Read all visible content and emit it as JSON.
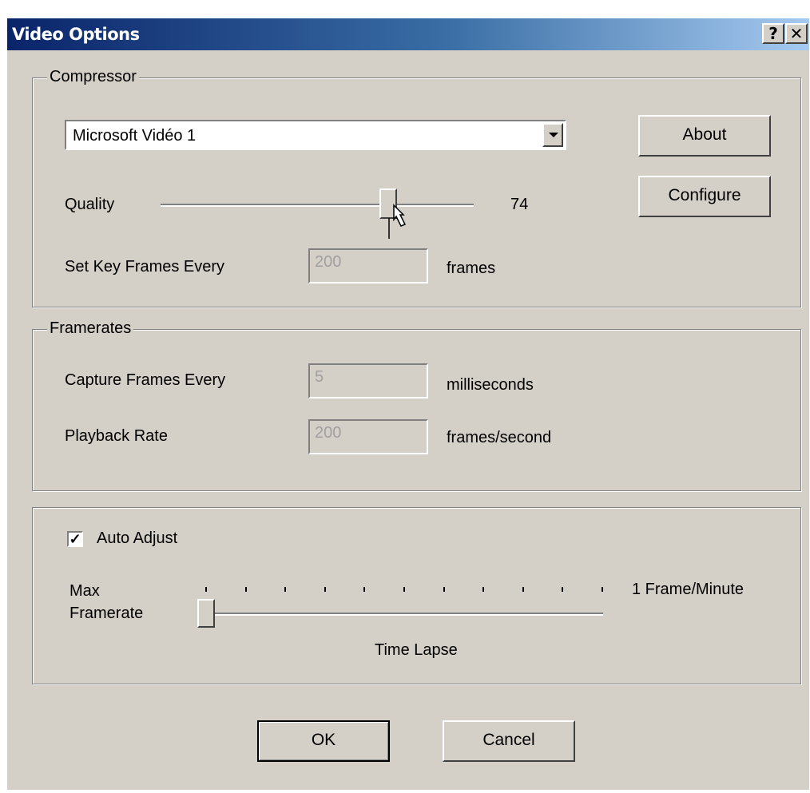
{
  "window": {
    "title": "Video Options",
    "help_label": "?",
    "close_label": "✕"
  },
  "compressor": {
    "group_label": "Compressor",
    "codec_value": "Microsoft Vidéo 1",
    "about_label": "About",
    "configure_label": "Configure",
    "quality_label": "Quality",
    "quality_value": "74",
    "quality_fraction": 0.74,
    "key_frames_label": "Set Key Frames Every",
    "key_frames_value": "200",
    "key_frames_unit": "frames"
  },
  "framerates": {
    "group_label": "Framerates",
    "capture_label": "Capture Frames Every",
    "capture_value": "5",
    "capture_unit": "milliseconds",
    "playback_label": "Playback Rate",
    "playback_value": "200",
    "playback_unit": "frames/second"
  },
  "auto_adjust": {
    "checkbox_label": "Auto Adjust",
    "checked": true,
    "max_framerate_label_line1": "Max",
    "max_framerate_label_line2": "Framerate",
    "end_label": "1 Frame/Minute",
    "bottom_label": "Time Lapse",
    "slider_fraction": 0
  },
  "buttons": {
    "ok_label": "OK",
    "cancel_label": "Cancel"
  }
}
